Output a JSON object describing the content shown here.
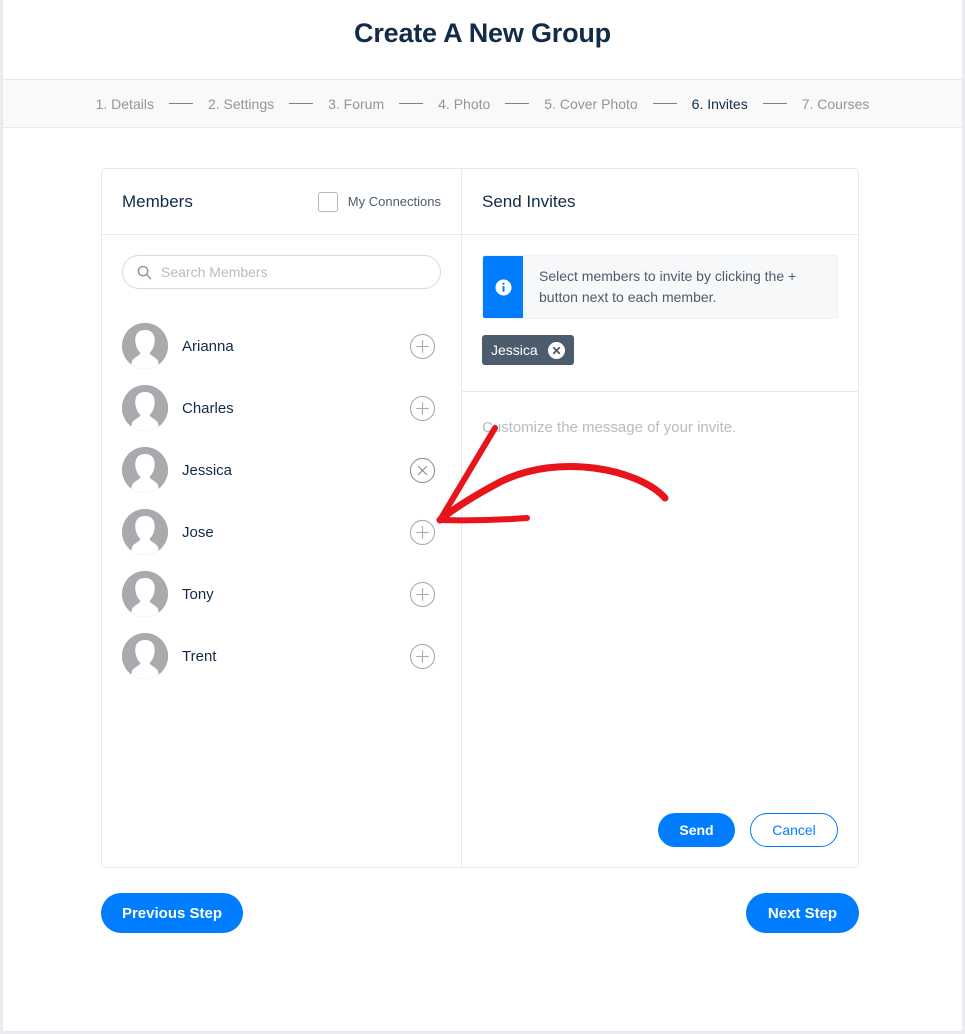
{
  "page": {
    "title": "Create A New Group"
  },
  "steps": [
    {
      "label": "1. Details",
      "current": false
    },
    {
      "label": "2. Settings",
      "current": false
    },
    {
      "label": "3. Forum",
      "current": false
    },
    {
      "label": "4. Photo",
      "current": false
    },
    {
      "label": "5. Cover Photo",
      "current": false
    },
    {
      "label": "6. Invites",
      "current": true
    },
    {
      "label": "7. Courses",
      "current": false
    }
  ],
  "members_panel": {
    "title": "Members",
    "my_connections_label": "My Connections",
    "my_connections_checked": false,
    "search_placeholder": "Search Members",
    "search_value": "",
    "members": [
      {
        "name": "Arianna",
        "action": "add"
      },
      {
        "name": "Charles",
        "action": "add"
      },
      {
        "name": "Jessica",
        "action": "remove"
      },
      {
        "name": "Jose",
        "action": "add"
      },
      {
        "name": "Tony",
        "action": "add"
      },
      {
        "name": "Trent",
        "action": "add"
      }
    ]
  },
  "invites_panel": {
    "title": "Send Invites",
    "info_text": "Select members to invite by clicking the + button next to each member.",
    "selected": [
      {
        "name": "Jessica"
      }
    ],
    "message_placeholder": "Customize the message of your invite.",
    "message_value": "",
    "send_label": "Send",
    "cancel_label": "Cancel"
  },
  "footer": {
    "previous_label": "Previous Step",
    "next_label": "Next Step"
  },
  "colors": {
    "accent": "#007cff",
    "text_dark": "#122b46",
    "tag_bg": "#4d5c6d",
    "annotation_arrow": "#e8141b"
  },
  "icons": {
    "search": "search-icon",
    "info": "info-icon",
    "add": "plus-circle-icon",
    "remove": "close-circle-icon",
    "tag_remove": "close-icon"
  }
}
